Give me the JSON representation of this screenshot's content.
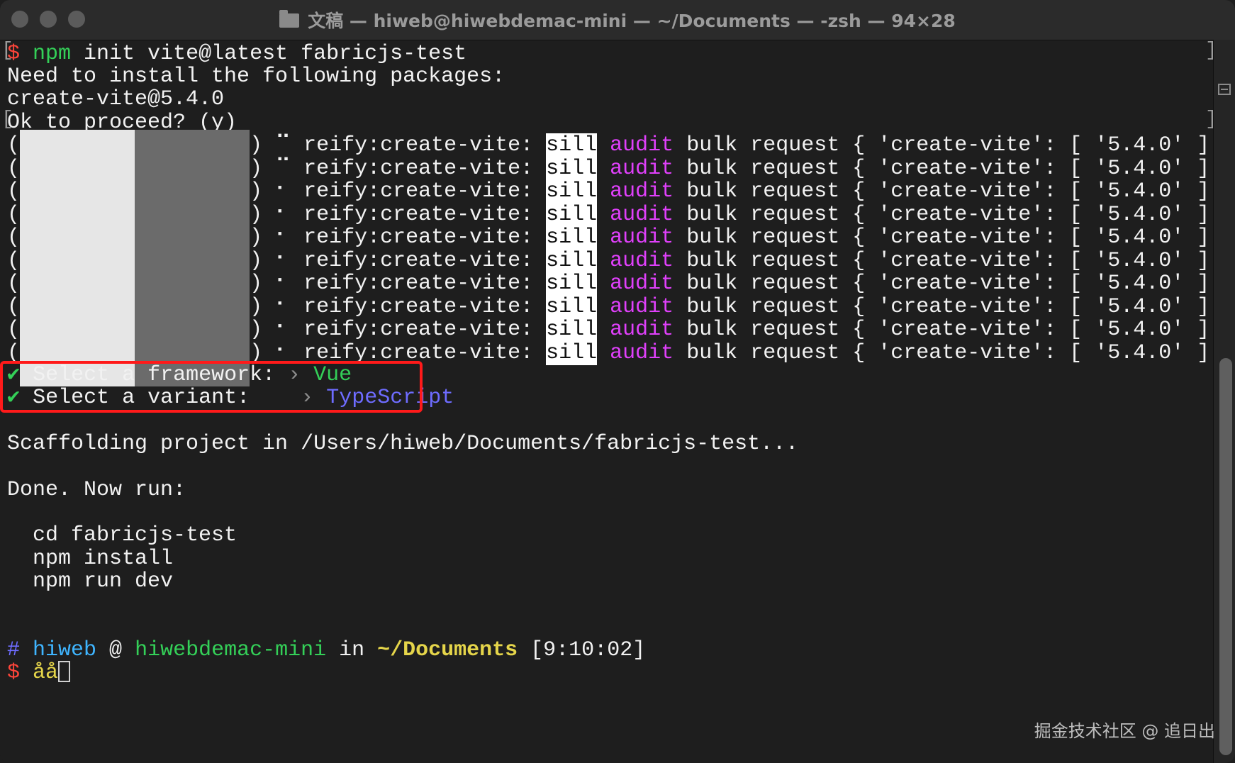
{
  "window": {
    "title": "文稿 — hiweb@hiwebdemac-mini — ~/Documents — -zsh — 94×28"
  },
  "prompt_top": {
    "symbol": "$",
    "cmd": "npm",
    "args": " init vite@latest fabricjs-test"
  },
  "lines": {
    "need": "Need to install the following packages:",
    "pkg": "create-vite@5.4.0",
    "ok": "Ok to proceed? (y)"
  },
  "reify": {
    "prefix": "reify:create-vite: ",
    "sill": "sill",
    "audit": "audit",
    "rest": " bulk request { 'create-vite': [ '5.4.0' ]"
  },
  "select": {
    "framework_label": "Select a framework: ",
    "framework_value": "Vue",
    "variant_label": "Select a variant: ",
    "variant_value": "TypeScript",
    "check": "✔",
    "arrow": "›"
  },
  "scaffold": "Scaffolding project in /Users/hiweb/Documents/fabricjs-test...",
  "done": "Done. Now run:",
  "cmds": [
    "cd fabricjs-test",
    "npm install",
    "npm run dev"
  ],
  "status": {
    "hash": "#",
    "user": "hiweb",
    "at": " @ ",
    "host": "hiwebdemac-mini",
    "in": " in ",
    "dir": "~/Documents",
    "time": " [9:10:02]"
  },
  "input": {
    "symbol": "$",
    "text": "åå"
  },
  "watermark": "掘金技术社区 @ 追日出",
  "colors": {
    "green": "#34d058",
    "red": "#ff453a",
    "magenta": "#e040fb",
    "blue": "#6e6cff",
    "cyan": "#3fb5ff",
    "yellow": "#e5d54a"
  }
}
